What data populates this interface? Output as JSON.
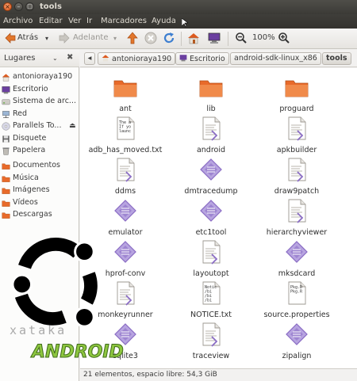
{
  "window": {
    "title": "tools"
  },
  "menu": [
    "Archivo",
    "Editar",
    "Ver",
    "Ir",
    "Marcadores",
    "Ayuda"
  ],
  "toolbar": {
    "back_label": "Atrás",
    "forward_label": "Adelante",
    "zoom_level": "100%"
  },
  "sidebar": {
    "header": "Lugares",
    "items": [
      {
        "label": "antonioraya190",
        "icon": "home-icon"
      },
      {
        "label": "Escritorio",
        "icon": "desktop-icon"
      },
      {
        "label": "Sistema de arc...",
        "icon": "drive-icon"
      },
      {
        "label": "Red",
        "icon": "network-icon"
      },
      {
        "label": "Parallels To...",
        "icon": "cd-icon"
      },
      {
        "label": "Disquete",
        "icon": "floppy-icon"
      },
      {
        "label": "Papelera",
        "icon": "trash-icon"
      },
      {
        "label": "Documentos",
        "icon": "folder-icon"
      },
      {
        "label": "Música",
        "icon": "folder-icon"
      },
      {
        "label": "Imágenes",
        "icon": "folder-icon"
      },
      {
        "label": "Vídeos",
        "icon": "folder-icon"
      },
      {
        "label": "Descargas",
        "icon": "folder-icon"
      }
    ]
  },
  "pathbar": [
    "antonioraya190",
    "Escritorio",
    "android-sdk-linux_x86",
    "tools"
  ],
  "files": [
    {
      "name": "ant",
      "type": "folder"
    },
    {
      "name": "lib",
      "type": "folder"
    },
    {
      "name": "proguard",
      "type": "folder"
    },
    {
      "name": "adb_has_moved.txt",
      "type": "text",
      "preview": [
        "The a",
        "If yo",
        "launc"
      ]
    },
    {
      "name": "android",
      "type": "script"
    },
    {
      "name": "apkbuilder",
      "type": "script"
    },
    {
      "name": "ddms",
      "type": "script"
    },
    {
      "name": "dmtracedump",
      "type": "binary"
    },
    {
      "name": "draw9patch",
      "type": "script"
    },
    {
      "name": "emulator",
      "type": "binary"
    },
    {
      "name": "etc1tool",
      "type": "binary"
    },
    {
      "name": "hierarchyviewer",
      "type": "script"
    },
    {
      "name": "hprof-conv",
      "type": "binary"
    },
    {
      "name": "layoutopt",
      "type": "script"
    },
    {
      "name": "mksdcard",
      "type": "binary"
    },
    {
      "name": "monkeyrunner",
      "type": "script"
    },
    {
      "name": "NOTICE.txt",
      "type": "text",
      "preview": [
        "Notic",
        "/bi",
        "/bi",
        "/bi"
      ]
    },
    {
      "name": "source.properties",
      "type": "text",
      "preview": [
        "Pkg.D",
        "Pkg.R"
      ]
    },
    {
      "name": "sqlite3",
      "type": "binary"
    },
    {
      "name": "traceview",
      "type": "script"
    },
    {
      "name": "zipalign",
      "type": "binary"
    }
  ],
  "status": "21 elementos, espacio libre: 54,3 GiB",
  "watermark": {
    "line1": "xataka",
    "line2": "ANDROID"
  },
  "colors": {
    "folder": "#e86a2a",
    "binary": "#8a6cc4",
    "titlebar": "#3c3b37",
    "accent": "#dd4814"
  }
}
